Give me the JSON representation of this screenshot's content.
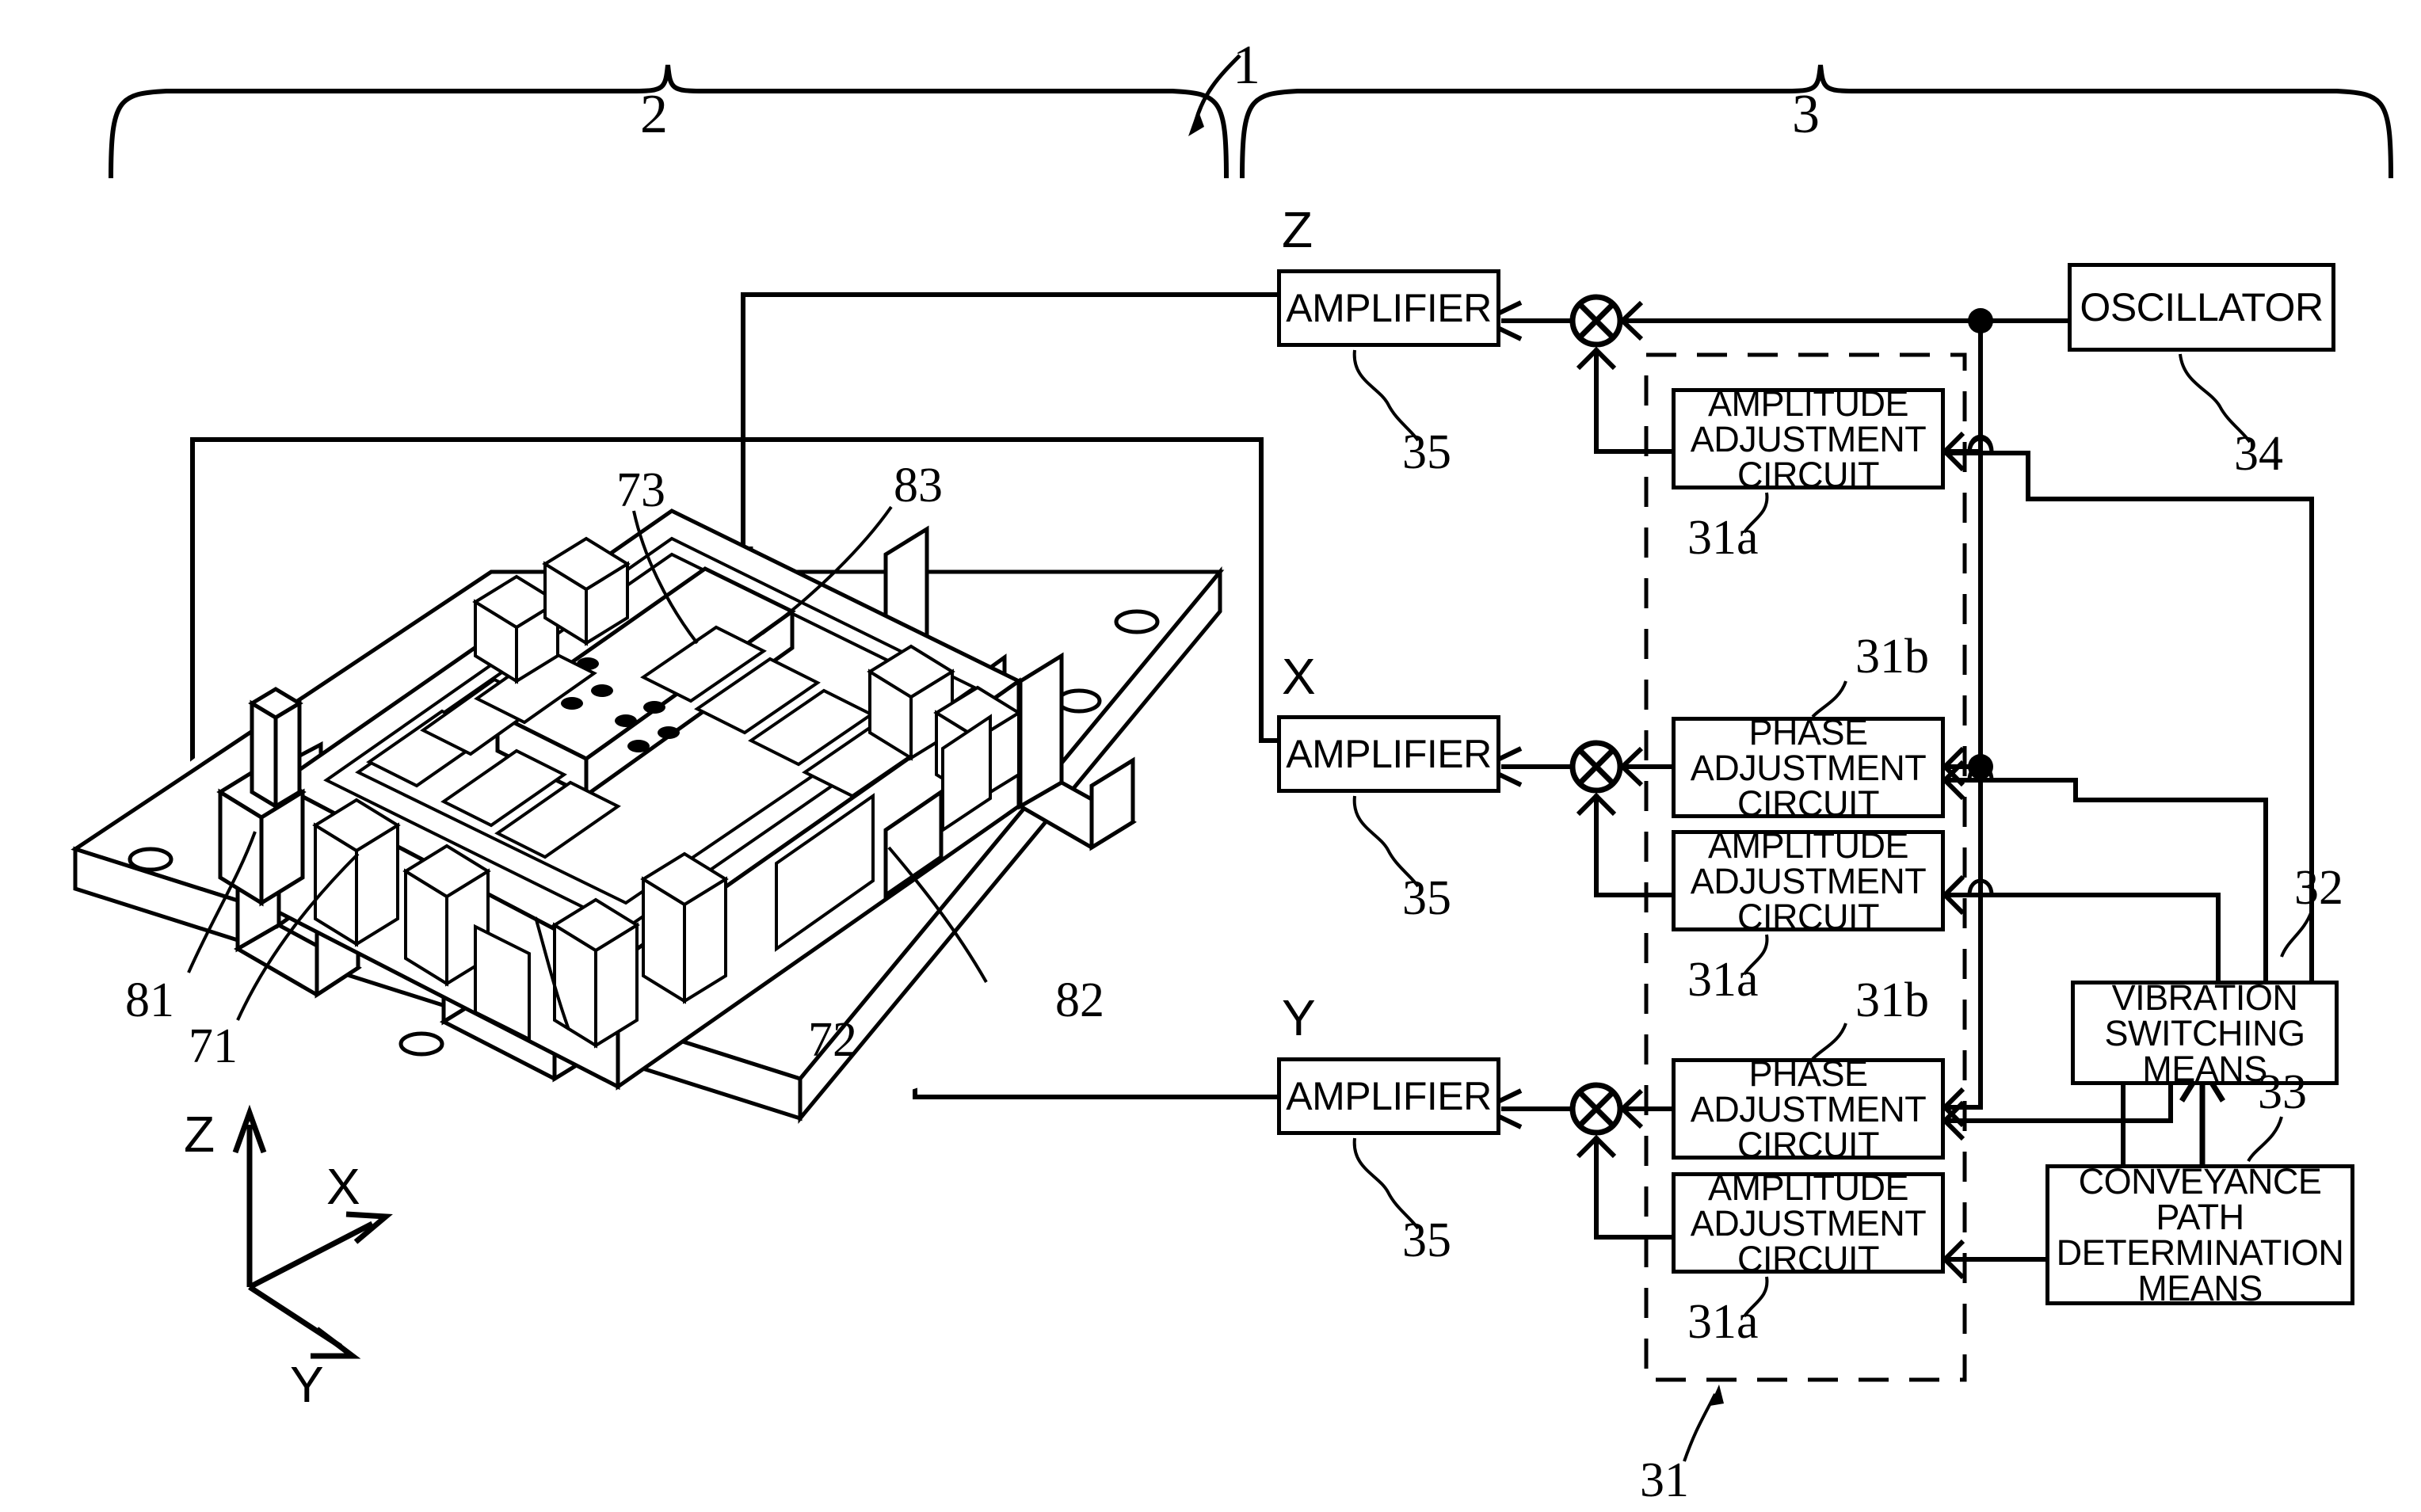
{
  "figure": {
    "title_refs": {
      "whole_system": "1",
      "mechanical_section": "2",
      "control_section": "3"
    }
  },
  "axes": {
    "z": "Z",
    "x": "X",
    "y": "Y"
  },
  "channel_labels": {
    "z": "Z",
    "x": "X",
    "y": "Y"
  },
  "blocks": {
    "amplifier_z": {
      "label": "AMPLIFIER",
      "ref": "35"
    },
    "amplifier_x": {
      "label": "AMPLIFIER",
      "ref": "35"
    },
    "amplifier_y": {
      "label": "AMPLIFIER",
      "ref": "35"
    },
    "oscillator": {
      "label": "OSCILLATOR",
      "ref": "34"
    },
    "amp_adj_z": {
      "line1": "AMPLITUDE",
      "line2": "ADJUSTMENT",
      "line3": "CIRCUIT",
      "ref": "31a"
    },
    "phase_adj_x": {
      "line1": "PHASE",
      "line2": "ADJUSTMENT",
      "line3": "CIRCUIT",
      "ref": "31b"
    },
    "amp_adj_x": {
      "line1": "AMPLITUDE",
      "line2": "ADJUSTMENT",
      "line3": "CIRCUIT",
      "ref": "31a"
    },
    "phase_adj_y": {
      "line1": "PHASE",
      "line2": "ADJUSTMENT",
      "line3": "CIRCUIT",
      "ref": "31b"
    },
    "amp_adj_y": {
      "line1": "AMPLITUDE",
      "line2": "ADJUSTMENT",
      "line3": "CIRCUIT",
      "ref": "31a"
    },
    "vibration_switching": {
      "line1": "VIBRATION",
      "line2": "SWITCHING",
      "line3": "MEANS",
      "ref": "32"
    },
    "conveyance_path": {
      "line1": "CONVEYANCE",
      "line2": "PATH",
      "line3": "DETERMINATION",
      "line4": "MEANS",
      "ref": "33"
    },
    "signal_group_dashed": {
      "ref": "31"
    }
  },
  "mechanical_refs": {
    "base_plate": "71",
    "stage_body": "72",
    "upper_stage": "73",
    "piezo_x": "81",
    "piezo_y": "82",
    "piezo_z": "83"
  },
  "colors": {
    "line": "#000000",
    "background": "#ffffff"
  }
}
